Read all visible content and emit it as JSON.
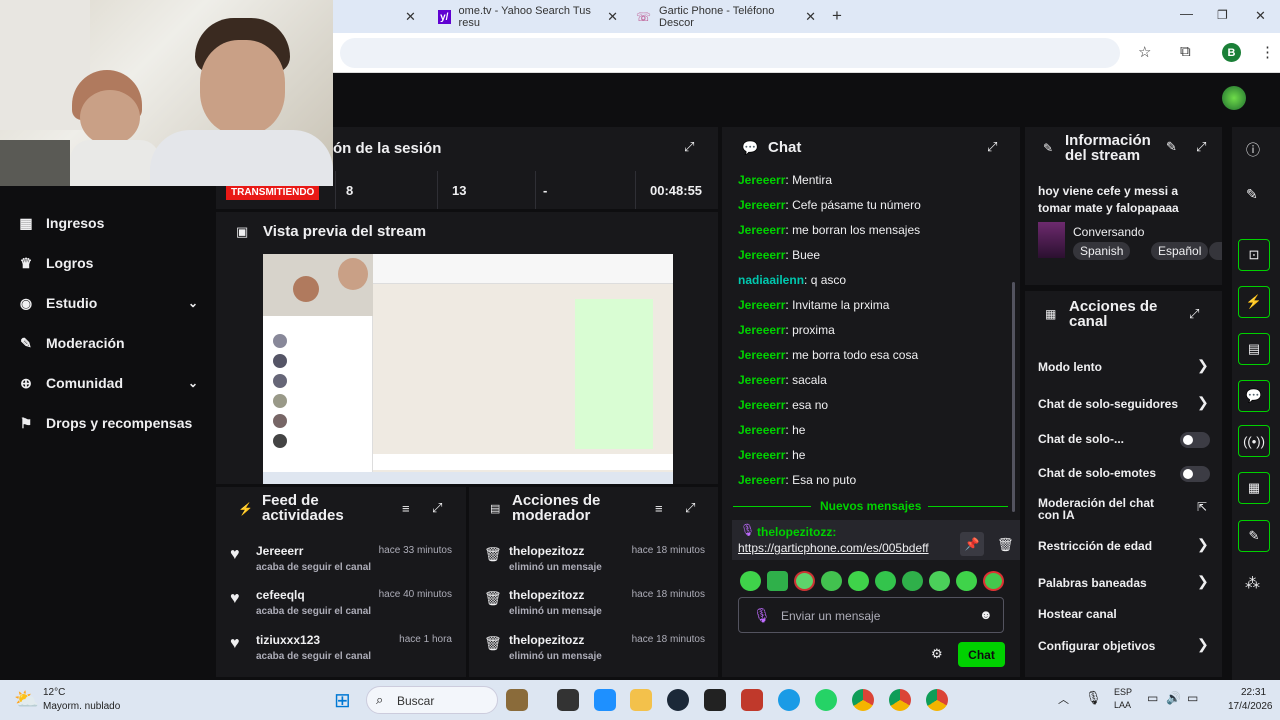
{
  "browser": {
    "tabs": [
      {
        "title": "ome.tv - Yahoo Search Tus resu"
      },
      {
        "title": "Gartic Phone - Teléfono Descor"
      }
    ],
    "profile_letter": "B"
  },
  "sidebar": {
    "items": [
      {
        "label": "Ingresos",
        "icon": "bars-chart-icon"
      },
      {
        "label": "Logros",
        "icon": "trophy-icon"
      },
      {
        "label": "Estudio",
        "icon": "studio-icon"
      },
      {
        "label": "Moderación",
        "icon": "wrench-icon"
      },
      {
        "label": "Comunidad",
        "icon": "globe-icon"
      },
      {
        "label": "Drops y recompensas",
        "icon": "gift-icon"
      }
    ]
  },
  "session": {
    "title": "ón de la sesión",
    "status": "TRANSMITIENDO",
    "viewers": "8",
    "followers": "13",
    "subs": "-",
    "duration": "00:48:55"
  },
  "preview": {
    "title": "Vista previa del stream"
  },
  "chat": {
    "title": "Chat",
    "messages": [
      {
        "user": "Jereeerr",
        "text": "Mentira"
      },
      {
        "user": "Jereeerr",
        "text": "Cefe pásame tu número"
      },
      {
        "user": "Jereeerr",
        "text": "me borran los mensajes"
      },
      {
        "user": "Jereeerr",
        "text": "Buee"
      },
      {
        "user": "nadiaailenn",
        "text": "q asco"
      },
      {
        "user": "Jereeerr",
        "text": "Invitame la prxima"
      },
      {
        "user": "Jereeerr",
        "text": "proxima"
      },
      {
        "user": "Jereeerr",
        "text": "me borra todo esa cosa"
      },
      {
        "user": "Jereeerr",
        "text": "sacala"
      },
      {
        "user": "Jereeerr",
        "text": "esa no"
      },
      {
        "user": "Jereeerr",
        "text": "he"
      },
      {
        "user": "Jereeerr",
        "text": "he"
      },
      {
        "user": "Jereeerr",
        "text": "Esa no puto"
      }
    ],
    "new_messages_label": "Nuevos mensajes",
    "pinned_user": "thelopezitozz:",
    "pinned_link": "https://garticphone.com/es/005bdeff",
    "input_placeholder": "Enviar un mensaje",
    "send_label": "Chat"
  },
  "stream_info": {
    "title_line1": "Información",
    "title_line2": "del stream",
    "stream_title": "hoy viene cefe y messi a tomar mate y falopapaaa",
    "category": "Conversando",
    "tags": [
      "Spanish",
      "Español"
    ]
  },
  "channel_actions": {
    "title_line1": "Acciones de",
    "title_line2": "canal",
    "items": [
      {
        "label": "Modo lento",
        "control": "arrow"
      },
      {
        "label": "Chat de solo-seguidores",
        "control": "arrow"
      },
      {
        "label": "Chat de solo-...",
        "control": "toggle"
      },
      {
        "label": "Chat de solo-emotes",
        "control": "toggle"
      },
      {
        "label": "Moderación del chat con IA",
        "control": "external"
      },
      {
        "label": "Restricción de edad",
        "control": "arrow"
      },
      {
        "label": "Palabras baneadas",
        "control": "arrow"
      },
      {
        "label": "Hostear canal",
        "control": "none"
      },
      {
        "label": "Configurar objetivos",
        "control": "arrow"
      }
    ]
  },
  "activity_feed": {
    "title_line1": "Feed de",
    "title_line2": "actividades",
    "items": [
      {
        "user": "Jereeerr",
        "action": "acaba de seguir el canal",
        "time": "hace 33 minutos"
      },
      {
        "user": "cefeeqlq",
        "action": "acaba de seguir el canal",
        "time": "hace 40 minutos"
      },
      {
        "user": "tiziuxxx123",
        "action": "acaba de seguir el canal",
        "time": "hace 1 hora"
      }
    ]
  },
  "mod_actions": {
    "title_line1": "Acciones de",
    "title_line2": "moderador",
    "items": [
      {
        "user": "thelopezitozz",
        "action": "eliminó un mensaje",
        "time": "hace 18 minutos"
      },
      {
        "user": "thelopezitozz",
        "action": "eliminó un mensaje",
        "time": "hace 18 minutos"
      },
      {
        "user": "thelopezitozz",
        "action": "eliminó un mensaje",
        "time": "hace 18 minutos"
      }
    ]
  },
  "taskbar": {
    "weather_temp": "12°C",
    "weather_desc": "Mayorm. nublado",
    "search_label": "Buscar",
    "lang1": "ESP",
    "lang2": "LAA",
    "time": "22:31",
    "date": "17/4/2026"
  }
}
